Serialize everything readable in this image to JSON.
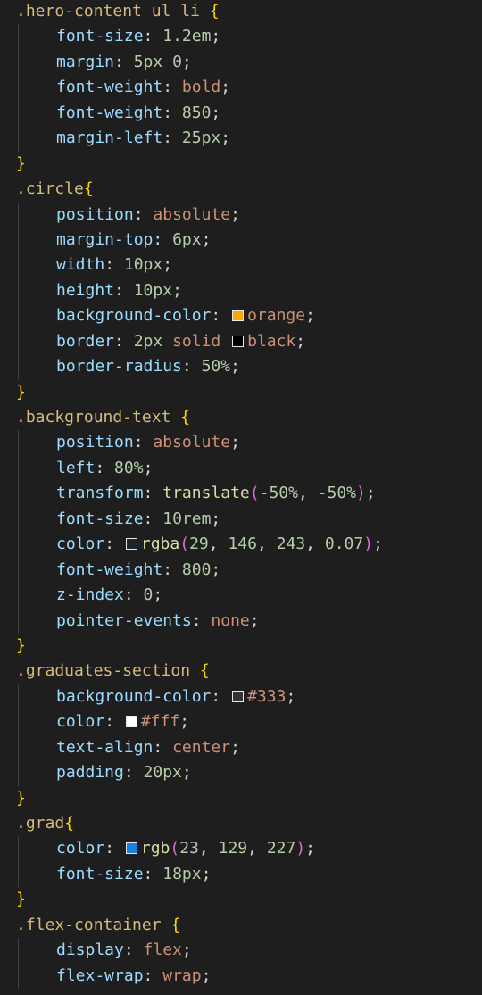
{
  "editor": {
    "lines": [
      {
        "t": "rule",
        "sel": ".hero-content ul li",
        "space": true
      },
      {
        "t": "decl",
        "prop": "font-size",
        "tokens": [
          {
            "c": "num",
            "v": "1.2em"
          }
        ]
      },
      {
        "t": "decl",
        "prop": "margin",
        "tokens": [
          {
            "c": "num",
            "v": "5px"
          },
          {
            "c": "punct",
            "v": " "
          },
          {
            "c": "num",
            "v": "0"
          }
        ]
      },
      {
        "t": "decl",
        "prop": "font-weight",
        "tokens": [
          {
            "c": "kw",
            "v": "bold"
          }
        ]
      },
      {
        "t": "decl",
        "prop": "font-weight",
        "tokens": [
          {
            "c": "num",
            "v": "850"
          }
        ]
      },
      {
        "t": "decl",
        "prop": "margin-left",
        "tokens": [
          {
            "c": "num",
            "v": "25px"
          }
        ]
      },
      {
        "t": "close"
      },
      {
        "t": "rule",
        "sel": ".circle",
        "space": false
      },
      {
        "t": "decl",
        "prop": "position",
        "tokens": [
          {
            "c": "kw",
            "v": "absolute"
          }
        ]
      },
      {
        "t": "decl",
        "prop": "margin-top",
        "tokens": [
          {
            "c": "num",
            "v": "6px"
          }
        ]
      },
      {
        "t": "decl",
        "prop": "width",
        "tokens": [
          {
            "c": "num",
            "v": "10px"
          }
        ]
      },
      {
        "t": "decl",
        "prop": "height",
        "tokens": [
          {
            "c": "num",
            "v": "10px"
          }
        ]
      },
      {
        "t": "decl",
        "prop": "background-color",
        "tokens": [
          {
            "c": "swatch",
            "color": "#ffa500"
          },
          {
            "c": "kw",
            "v": "orange"
          }
        ]
      },
      {
        "t": "decl",
        "prop": "border",
        "tokens": [
          {
            "c": "num",
            "v": "2px"
          },
          {
            "c": "punct",
            "v": " "
          },
          {
            "c": "kw",
            "v": "solid"
          },
          {
            "c": "punct",
            "v": " "
          },
          {
            "c": "swatch",
            "color": "#000000"
          },
          {
            "c": "kw",
            "v": "black"
          }
        ]
      },
      {
        "t": "decl",
        "prop": "border-radius",
        "tokens": [
          {
            "c": "num",
            "v": "50%"
          }
        ]
      },
      {
        "t": "close"
      },
      {
        "t": "rule",
        "sel": ".background-text",
        "space": true
      },
      {
        "t": "decl",
        "prop": "position",
        "tokens": [
          {
            "c": "kw",
            "v": "absolute"
          }
        ]
      },
      {
        "t": "decl",
        "prop": "left",
        "tokens": [
          {
            "c": "num",
            "v": "80%"
          }
        ]
      },
      {
        "t": "decl",
        "prop": "transform",
        "tokens": [
          {
            "c": "fn",
            "v": "translate"
          },
          {
            "c": "paren",
            "v": "("
          },
          {
            "c": "num",
            "v": "-50%"
          },
          {
            "c": "punct",
            "v": ", "
          },
          {
            "c": "num",
            "v": "-50%"
          },
          {
            "c": "paren",
            "v": ")"
          }
        ]
      },
      {
        "t": "decl",
        "prop": "font-size",
        "tokens": [
          {
            "c": "num",
            "v": "10rem"
          }
        ]
      },
      {
        "t": "decl",
        "prop": "color",
        "tokens": [
          {
            "c": "swatch",
            "color": "rgba(29,146,243,0.07)"
          },
          {
            "c": "fn",
            "v": "rgba"
          },
          {
            "c": "paren",
            "v": "("
          },
          {
            "c": "num",
            "v": "29"
          },
          {
            "c": "punct",
            "v": ", "
          },
          {
            "c": "num",
            "v": "146"
          },
          {
            "c": "punct",
            "v": ", "
          },
          {
            "c": "num",
            "v": "243"
          },
          {
            "c": "punct",
            "v": ", "
          },
          {
            "c": "num",
            "v": "0.07"
          },
          {
            "c": "paren",
            "v": ")"
          }
        ]
      },
      {
        "t": "decl",
        "prop": "font-weight",
        "tokens": [
          {
            "c": "num",
            "v": "800"
          }
        ]
      },
      {
        "t": "decl",
        "prop": "z-index",
        "tokens": [
          {
            "c": "num",
            "v": "0"
          }
        ]
      },
      {
        "t": "decl",
        "prop": "pointer-events",
        "tokens": [
          {
            "c": "kw",
            "v": "none"
          }
        ]
      },
      {
        "t": "close"
      },
      {
        "t": "rule",
        "sel": ".graduates-section",
        "space": true
      },
      {
        "t": "decl",
        "prop": "background-color",
        "tokens": [
          {
            "c": "swatch",
            "color": "#333333"
          },
          {
            "c": "kw",
            "v": "#333"
          }
        ]
      },
      {
        "t": "decl",
        "prop": "color",
        "tokens": [
          {
            "c": "swatch",
            "color": "#ffffff"
          },
          {
            "c": "kw",
            "v": "#fff"
          }
        ]
      },
      {
        "t": "decl",
        "prop": "text-align",
        "tokens": [
          {
            "c": "kw",
            "v": "center"
          }
        ]
      },
      {
        "t": "decl",
        "prop": "padding",
        "tokens": [
          {
            "c": "num",
            "v": "20px"
          }
        ]
      },
      {
        "t": "close"
      },
      {
        "t": "rule",
        "sel": ".grad",
        "space": false
      },
      {
        "t": "decl",
        "prop": "color",
        "tokens": [
          {
            "c": "swatch",
            "color": "#1781e3"
          },
          {
            "c": "fn",
            "v": "rgb"
          },
          {
            "c": "paren",
            "v": "("
          },
          {
            "c": "num",
            "v": "23"
          },
          {
            "c": "punct",
            "v": ", "
          },
          {
            "c": "num",
            "v": "129"
          },
          {
            "c": "punct",
            "v": ", "
          },
          {
            "c": "num",
            "v": "227"
          },
          {
            "c": "paren",
            "v": ")"
          }
        ]
      },
      {
        "t": "decl",
        "prop": "font-size",
        "tokens": [
          {
            "c": "num",
            "v": "18px"
          }
        ]
      },
      {
        "t": "close"
      },
      {
        "t": "rule",
        "sel": ".flex-container",
        "space": true
      },
      {
        "t": "decl",
        "prop": "display",
        "tokens": [
          {
            "c": "kw",
            "v": "flex"
          }
        ]
      },
      {
        "t": "decl",
        "prop": "flex-wrap",
        "tokens": [
          {
            "c": "kw",
            "v": "wrap"
          }
        ]
      }
    ]
  },
  "colors": {
    "background": "#1e1e1e",
    "selector": "#d7ba7d",
    "brace": "#ffd700",
    "property": "#9cdcfe",
    "number": "#b5cea8",
    "keyword": "#ce9178",
    "function": "#dcdcaa",
    "paren": "#da70d6"
  }
}
